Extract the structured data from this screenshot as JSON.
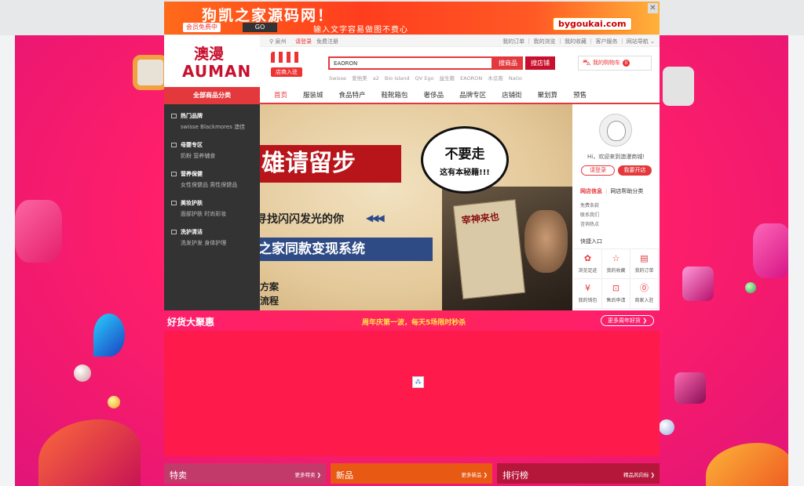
{
  "ad": {
    "title": "狗凯之家源码网！",
    "tag": "会员免费中",
    "go": "GO",
    "subtitle": "输入文字容易做图不费心",
    "url": "bygoukai.com",
    "close": "✕"
  },
  "logo": {
    "cn": "澳漫",
    "en": "AUMAN"
  },
  "topbar": {
    "location": "泉州",
    "login": "请登录",
    "register": "免费注册",
    "links": "我的订单 ｜ 我的浏览 ｜ 我的收藏 ｜ 客户服务 ｜ 网站导航 ⌄"
  },
  "search": {
    "value": "EAORON",
    "btn_goods": "搜商品",
    "btn_shop": "搜店铺",
    "hotwords": [
      "Swisse",
      "爱他美",
      "a2",
      "Bio Island",
      "QV Ego",
      "益生菌",
      "EAORON",
      "木瓜膏",
      "Natio"
    ]
  },
  "shop_logo_sign": "店商入驻",
  "cart": {
    "label": "我的购物车",
    "count": "0"
  },
  "nav": {
    "all": "全部商品分类",
    "items": [
      "首页",
      "服装城",
      "食品特产",
      "鞋靴箱包",
      "奢侈品",
      "品牌专区",
      "店铺街",
      "聚划算",
      "预售"
    ]
  },
  "categories": [
    {
      "title": "热门品牌",
      "sub": "swisse   Blackmores 澳佳"
    },
    {
      "title": "母婴专区",
      "sub": "奶粉   营养辅食"
    },
    {
      "title": "营养保健",
      "sub": "女性保健品   男性保健品"
    },
    {
      "title": "美妆护肤",
      "sub": "面部护肤   时尚彩妆"
    },
    {
      "title": "洗护清洁",
      "sub": "洗发护发   身体护理"
    }
  ],
  "hero": {
    "red": "雄请留步",
    "line2": "寻找闪闪发光的你",
    "arrows": "◀◀◀",
    "blue": "之家同款变现系统",
    "l4": "方案",
    "l5": "流程",
    "bubble1": "不要走",
    "bubble2": "这有本秘籍!!!",
    "book": "宰神来也"
  },
  "user": {
    "welcome": "Hi，欢迎来到澳漫商城!",
    "login": "请登录",
    "open": "我要开店",
    "tab1": "网店信息",
    "tab2": "网店帮助分类",
    "list": [
      "免费条款",
      "联系我们",
      "咨询热点"
    ],
    "quick_title": "快捷入口",
    "quick": [
      {
        "icon": "✿",
        "label": "浏览足迹"
      },
      {
        "icon": "☆",
        "label": "我的收藏"
      },
      {
        "icon": "▤",
        "label": "我的订单"
      },
      {
        "icon": "¥",
        "label": "我的钱包"
      },
      {
        "icon": "⊡",
        "label": "售后申请"
      },
      {
        "icon": "⓪",
        "label": "商家入驻"
      }
    ]
  },
  "deals": {
    "title": "好货大聚惠",
    "center": "周年庆第一波，每天5场限时秒杀",
    "more": "更多周年好货 ❯"
  },
  "tabs": {
    "sale": {
      "title": "特卖",
      "more": "更多特卖 ❯"
    },
    "new": {
      "title": "新品",
      "more": "更多新品 ❯"
    },
    "rank": {
      "title": "排行榜",
      "more": "精品风向标 ❯"
    }
  }
}
